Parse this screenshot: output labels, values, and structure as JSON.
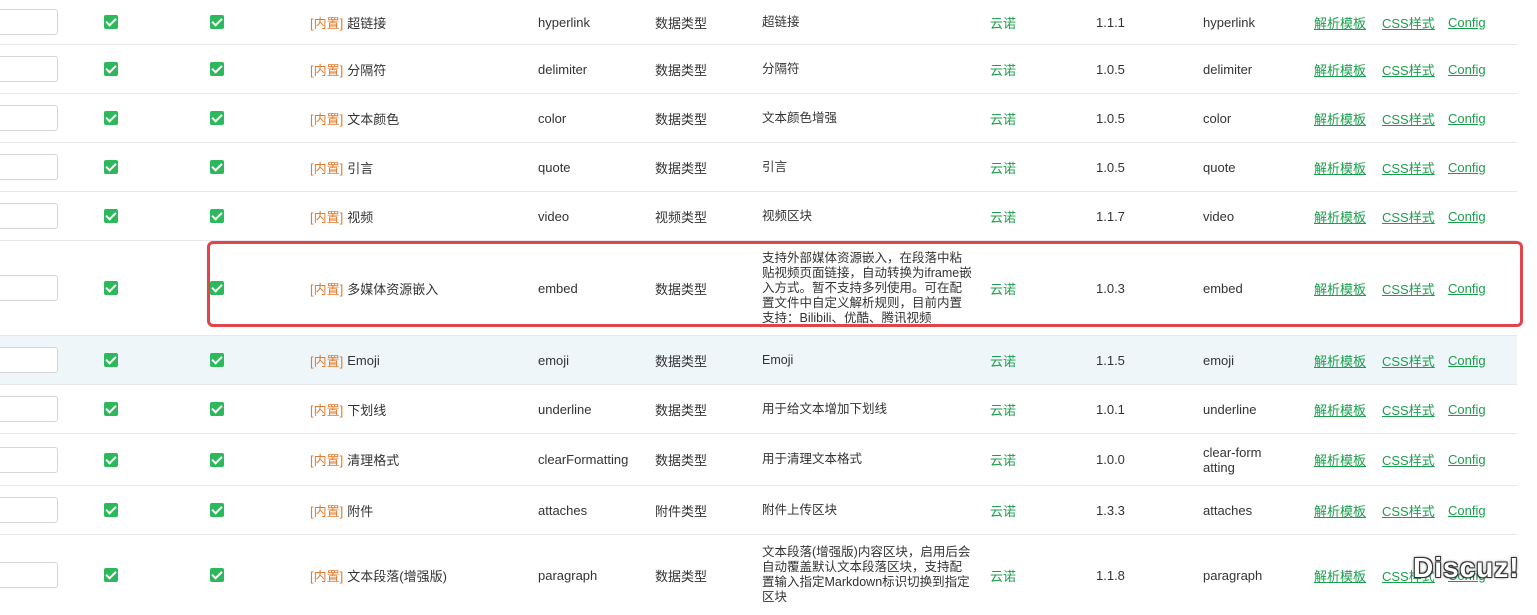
{
  "colors": {
    "accent_green": "#1b9f4d",
    "builtin_orange": "#e07a2e",
    "highlight_red": "#e0454c",
    "checkbox_green": "#2eb85c"
  },
  "rows": [
    {
      "name_cn": "超链接",
      "identifier": "hyperlink",
      "type": "数据类型",
      "desc": "超链接",
      "author": "云诺",
      "version": "1.1.1",
      "class": "hyperlink"
    },
    {
      "name_cn": "分隔符",
      "identifier": "delimiter",
      "type": "数据类型",
      "desc": "分隔符",
      "author": "云诺",
      "version": "1.0.5",
      "class": "delimiter"
    },
    {
      "name_cn": "文本颜色",
      "identifier": "color",
      "type": "数据类型",
      "desc": "文本颜色增强",
      "author": "云诺",
      "version": "1.0.5",
      "class": "color"
    },
    {
      "name_cn": "引言",
      "identifier": "quote",
      "type": "数据类型",
      "desc": "引言",
      "author": "云诺",
      "version": "1.0.5",
      "class": "quote"
    },
    {
      "name_cn": "视频",
      "identifier": "video",
      "type": "视频类型",
      "desc": "视频区块",
      "author": "云诺",
      "version": "1.1.7",
      "class": "video"
    },
    {
      "name_cn": "多媒体资源嵌入",
      "identifier": "embed",
      "type": "数据类型",
      "desc": "支持外部媒体资源嵌入，在段落中粘贴视频页面链接，自动转换为iframe嵌入方式。暂不支持多列使用。可在配置文件中自定义解析规则，目前内置支持：Bilibili、优酷、腾讯视频",
      "author": "云诺",
      "version": "1.0.3",
      "class": "embed"
    },
    {
      "name_cn": "Emoji",
      "identifier": "emoji",
      "type": "数据类型",
      "desc": "Emoji",
      "author": "云诺",
      "version": "1.1.5",
      "class": "emoji"
    },
    {
      "name_cn": "下划线",
      "identifier": "underline",
      "type": "数据类型",
      "desc": "用于给文本增加下划线",
      "author": "云诺",
      "version": "1.0.1",
      "class": "underline"
    },
    {
      "name_cn": "清理格式",
      "identifier": "clearFormatting",
      "type": "数据类型",
      "desc": "用于清理文本格式",
      "author": "云诺",
      "version": "1.0.0",
      "class": "clear-formatting"
    },
    {
      "name_cn": "附件",
      "identifier": "attaches",
      "type": "附件类型",
      "desc": "附件上传区块",
      "author": "云诺",
      "version": "1.3.3",
      "class": "attaches"
    },
    {
      "name_cn": "文本段落(增强版)",
      "identifier": "paragraph",
      "type": "数据类型",
      "desc": "文本段落(增强版)内容区块，启用后会自动覆盖默认文本段落区块，支持配置输入指定Markdown标识切换到指定区块",
      "author": "云诺",
      "version": "1.1.8",
      "class": "paragraph"
    }
  ],
  "labels": {
    "builtin": "[内置]",
    "parse_template": "解析模板",
    "css_style": "CSS样式",
    "config": "Config"
  },
  "watermark": "Discuz!"
}
